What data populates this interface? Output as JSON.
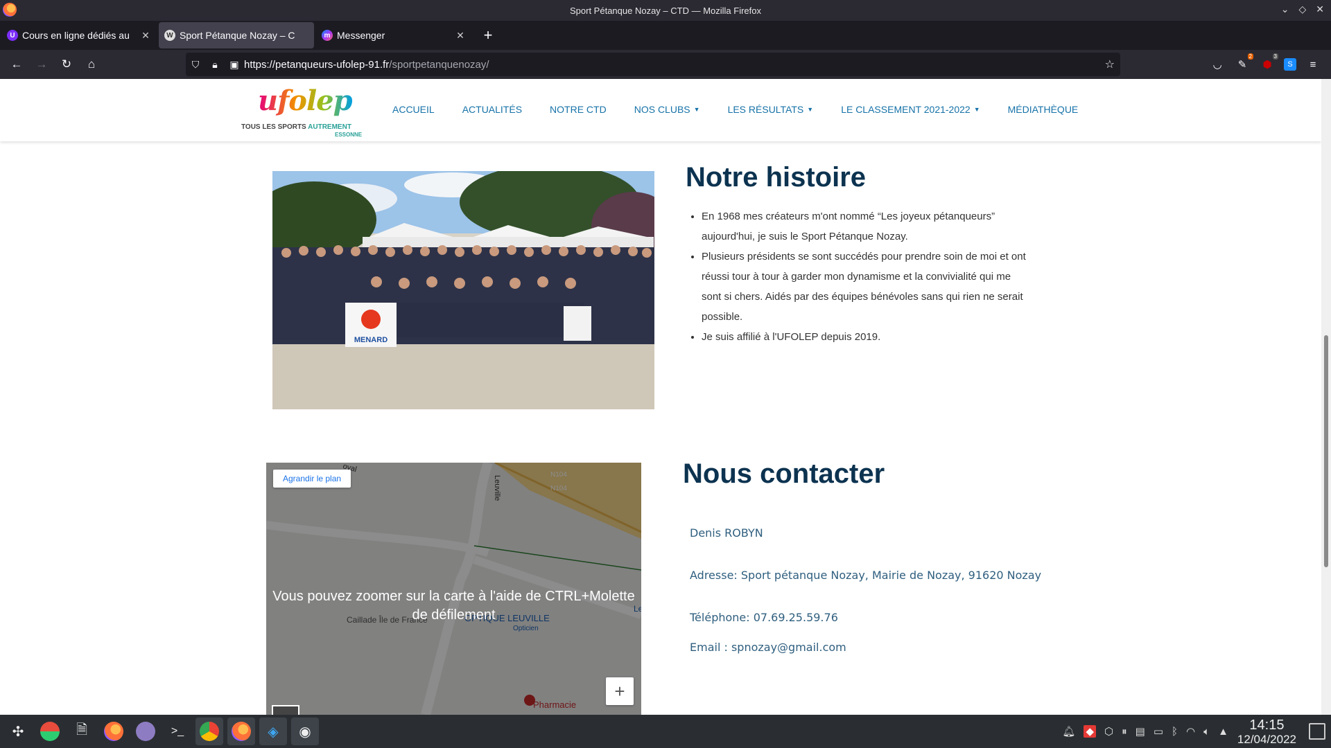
{
  "window": {
    "title": "Sport Pétanque Nozay – CTD — Mozilla Firefox"
  },
  "tabs": [
    {
      "label": "Cours en ligne dédiés au",
      "favicon_color": "#7b2ff7",
      "favicon_char": "U"
    },
    {
      "label": "Sport Pétanque Nozay – C",
      "favicon_color": "#555555",
      "favicon_char": "W"
    },
    {
      "label": "Messenger",
      "favicon_color": "#a033ff",
      "favicon_char": "m"
    }
  ],
  "url": {
    "host": "https://petanqueurs-ufolep-91.fr",
    "path": "/sportpetanquenozay/"
  },
  "toolbar_badges": {
    "ext1": "2",
    "ext2": "3"
  },
  "site": {
    "logo": {
      "word": "ufolep",
      "tag_main": "TOUS LES SPORTS",
      "tag_accent": "AUTREMENT",
      "sub": "ESSONNE"
    },
    "menu": [
      {
        "label": "ACCUEIL",
        "dropdown": false
      },
      {
        "label": "ACTUALITÉS",
        "dropdown": false
      },
      {
        "label": "NOTRE CTD",
        "dropdown": false
      },
      {
        "label": "NOS CLUBS",
        "dropdown": true
      },
      {
        "label": "LES RÉSULTATS",
        "dropdown": true
      },
      {
        "label": "LE CLASSEMENT 2021-2022",
        "dropdown": true
      },
      {
        "label": "MÉDIATHÈQUE",
        "dropdown": false
      }
    ]
  },
  "histoire": {
    "title": "Notre histoire",
    "items": [
      "En 1968 mes créateurs m'ont nommé “Les joyeux pétanqueurs” aujourd'hui, je suis le Sport Pétanque Nozay.",
      "Plusieurs présidents se sont succédés pour prendre soin de moi et ont réussi tour à tour à garder mon dynamisme et la convivialité qui me sont si chers. Aidés par des équipes bénévoles sans qui rien ne serait possible.",
      "Je suis affilié à l'UFOLEP depuis 2019."
    ],
    "photo_sign": "MENARD"
  },
  "map": {
    "enlarge_label": "Agrandir le plan",
    "zoom_message": "Vous pouvez zoomer sur la carte à l'aide de CTRL+Molette de défilement",
    "road_labels": [
      "N104",
      "N104",
      "Leuville",
      "oyal"
    ],
    "poi_labels": [
      "OPTIQUE LEUVILLE",
      "Opticien",
      "Pharmacie",
      "Caillade Île de France",
      "Le"
    ],
    "zoom_in": "+"
  },
  "contact": {
    "title": "Nous contacter",
    "name": "Denis ROBYN",
    "address": "Adresse: Sport pétanque Nozay, Mairie de Nozay, 91620 Nozay",
    "phone": "Téléphone: 07.69.25.59.76",
    "email": "Email : spnozay@gmail.com"
  },
  "taskbar": {
    "time": "14:15",
    "date": "12/04/2022"
  }
}
